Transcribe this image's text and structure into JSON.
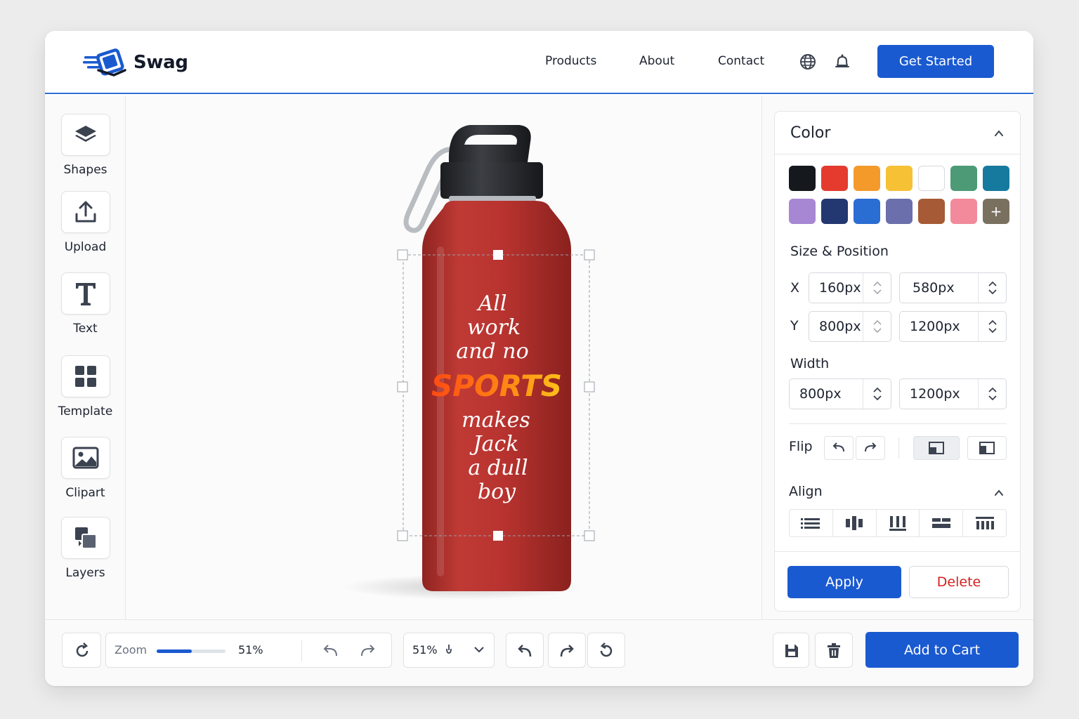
{
  "header": {
    "brand": "Swag",
    "nav": [
      "Products",
      "About",
      "Contact"
    ],
    "cta": "Get Started"
  },
  "tools": [
    {
      "label": "Shapes",
      "icon": "layers-stack-icon"
    },
    {
      "label": "Upload",
      "icon": "upload-icon"
    },
    {
      "label": "Text",
      "icon": "text-t-icon"
    },
    {
      "label": "Template",
      "icon": "grid-icon"
    },
    {
      "label": "Clipart",
      "icon": "image-icon"
    },
    {
      "label": "Layers",
      "icon": "layers-icon"
    }
  ],
  "design": {
    "lines_top": [
      "All",
      "work",
      "and no"
    ],
    "highlight": "SPORTS",
    "lines_bottom": [
      "makes",
      "Jack",
      "a dull",
      "boy"
    ],
    "bottle_color": "#b8332f"
  },
  "panel": {
    "color_title": "Color",
    "swatches": [
      "#15181c",
      "#e43b2e",
      "#f49a2b",
      "#f7c135",
      "#ffffff",
      "#4c9a76",
      "#167a9e",
      "#a787d3",
      "#233870",
      "#2a6dd3",
      "#6b6fac",
      "#a65a35",
      "#f28a9b"
    ],
    "add_swatch": "+",
    "size_title": "Size & Position",
    "x_label": "X",
    "y_label": "Y",
    "x_value": "160px",
    "x_value2": "580px",
    "y_value": "800px",
    "y_value2": "1200px",
    "width_title": "Width",
    "width_value": "800px",
    "width_value2": "1200px",
    "flip_label": "Flip",
    "align_label": "Align",
    "apply": "Apply",
    "delete": "Delete"
  },
  "bottom": {
    "zoom_label": "Zoom",
    "zoom_percent": "51%",
    "zoom_fraction": 0.51,
    "zoom_select": "51%",
    "add_to_cart": "Add to Cart"
  }
}
